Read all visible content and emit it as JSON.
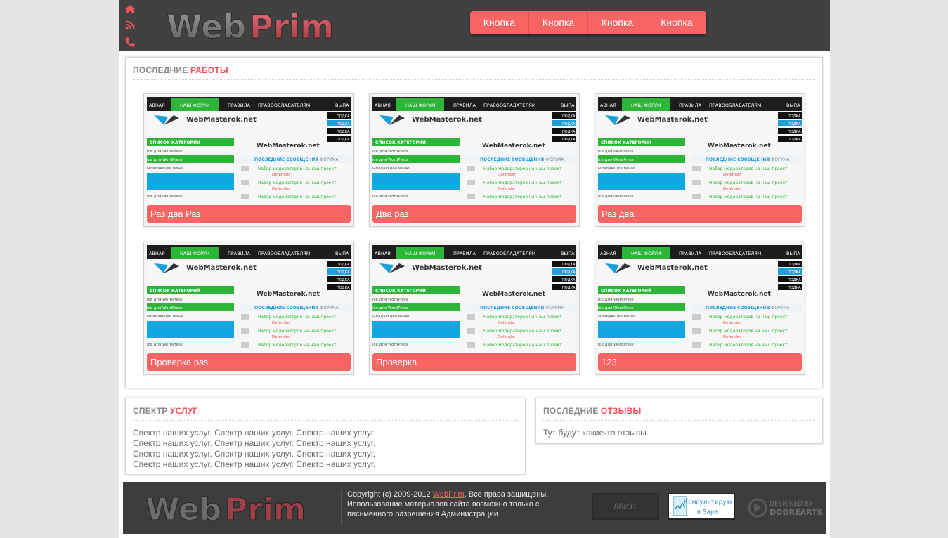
{
  "header": {
    "logo": "WebPrim",
    "nav": [
      {
        "label": "Кнопка"
      },
      {
        "label": "Кнопка"
      },
      {
        "label": "Кнопка"
      },
      {
        "label": "Кнопка"
      }
    ],
    "side_icons": [
      "home-icon",
      "rss-icon",
      "phone-icon"
    ]
  },
  "works": {
    "title_plain": "ПОСЛЕДНИЕ",
    "title_accent": "РАБОТЫ",
    "items": [
      {
        "label": "Раз два Раз"
      },
      {
        "label": "Два раз"
      },
      {
        "label": "Раз два"
      },
      {
        "label": "Проверка раз"
      },
      {
        "label": "Проверка"
      },
      {
        "label": "123"
      }
    ],
    "thumb": {
      "site_name": "WebMasterok.net",
      "menu_left": "АВНАЯ",
      "menu_forum": "НАШ ФОРУМ",
      "menu_rules": "ПРАВИЛА",
      "menu_owners": "ПРАВООБЛАДАТЕЛЯМ",
      "menu_right": "ВЫПА",
      "categories": "СПИСОК КАТЕГОРИЙ",
      "latest": "ПОСЛЕДНИЕ СООБЩЕНИЯ",
      "from_forum": "С ФОРУМА",
      "side_btn": "ПОДКА",
      "row_wp": "ice для WordPress",
      "row_menu": "ыпадающее меню",
      "row_mod": "Набор модераторов на наш проект",
      "row_author": "Defender"
    }
  },
  "services": {
    "title_plain": "СПЕКТР",
    "title_accent": "УСЛУГ",
    "lines": [
      "Спектр наших услуг. Спектр наших услуг. Спектр наших услуг.",
      "Спектр наших услуг. Спектр наших услуг. Спектр наших услуг.",
      "Спектр наших услуг. Спектр наших услуг. Спектр наших услуг.",
      "Спектр наших услуг. Спектр наших услуг. Спектр наших услуг."
    ]
  },
  "reviews": {
    "title_plain": "ПОСЛЕДНИЕ",
    "title_accent": "ОТЗЫВЫ",
    "text": "Тут будут какие-то отзывы."
  },
  "footer": {
    "logo": "WebPrim",
    "copyright_pre": "Copyright (c) 2009-2012 ",
    "copyright_link": "WebPrim",
    "copyright_post": ". Все права защищены.",
    "line2": "Использование материалов сайта возможно только с",
    "line3": "письменного разрешения Администрации.",
    "counter": "88x31",
    "sape_top": "Консультирую",
    "sape_bottom": "в Sape",
    "designed_top": "DESIGNED BY",
    "designed_bottom": "DODREARTS"
  },
  "colors": {
    "accent": "#f96464",
    "title_accent": "#f0525b",
    "header_bg": "#414141",
    "footer_bg": "#3d3d3d"
  }
}
